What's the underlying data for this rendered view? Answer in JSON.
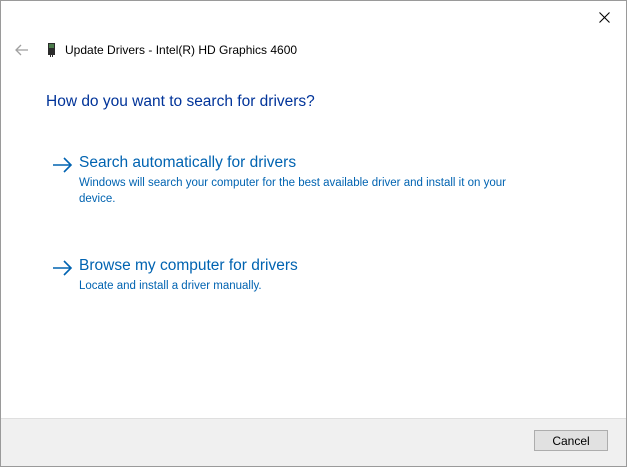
{
  "window": {
    "title": "Update Drivers - Intel(R) HD Graphics 4600"
  },
  "dialog": {
    "heading": "How do you want to search for drivers?",
    "options": [
      {
        "title": "Search automatically for drivers",
        "description": "Windows will search your computer for the best available driver and install it on your device."
      },
      {
        "title": "Browse my computer for drivers",
        "description": "Locate and install a driver manually."
      }
    ]
  },
  "footer": {
    "cancel_label": "Cancel"
  },
  "icons": {
    "close": "close-icon",
    "back": "back-arrow-icon",
    "device": "display-adapter-icon",
    "option_arrow": "right-arrow-icon"
  },
  "colors": {
    "heading": "#003399",
    "link": "#0063b1",
    "footer_bg": "#f0f0f0"
  }
}
